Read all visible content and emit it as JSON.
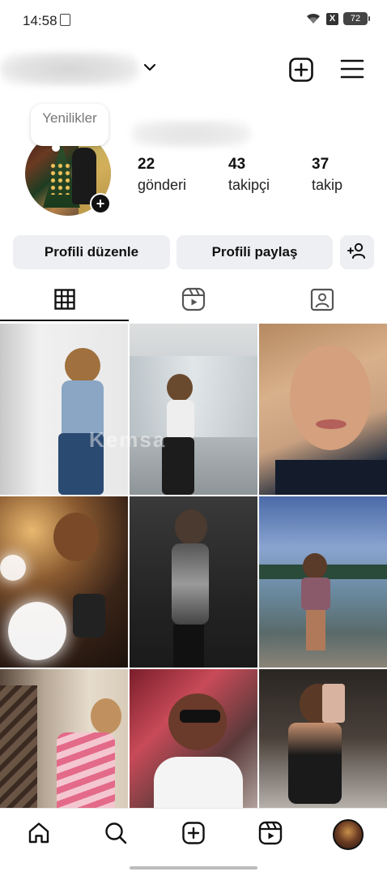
{
  "status_bar": {
    "time": "14:58",
    "battery": "72",
    "x_badge": "X"
  },
  "header": {
    "add_icon": "plus-square-icon",
    "menu_icon": "hamburger-menu-icon",
    "chevron_icon": "chevron-down-icon"
  },
  "profile": {
    "note": "Yenilikler",
    "stats": [
      {
        "value": "22",
        "label": "gönderi"
      },
      {
        "value": "43",
        "label": "takipçi"
      },
      {
        "value": "37",
        "label": "takip"
      }
    ]
  },
  "actions": {
    "edit_label": "Profili düzenle",
    "share_label": "Profili paylaş",
    "discover_icon": "add-person-icon"
  },
  "tabs": [
    {
      "icon": "grid-icon",
      "selected": true
    },
    {
      "icon": "reels-icon",
      "selected": false
    },
    {
      "icon": "tagged-icon",
      "selected": false
    }
  ],
  "grid": {
    "watermark": "Kemsa"
  },
  "bottom_nav": [
    {
      "icon": "home-icon"
    },
    {
      "icon": "search-icon"
    },
    {
      "icon": "create-icon"
    },
    {
      "icon": "reels-icon"
    },
    {
      "icon": "profile-avatar"
    }
  ],
  "colors": {
    "button_bg": "#eeeff2",
    "text": "#111111"
  }
}
